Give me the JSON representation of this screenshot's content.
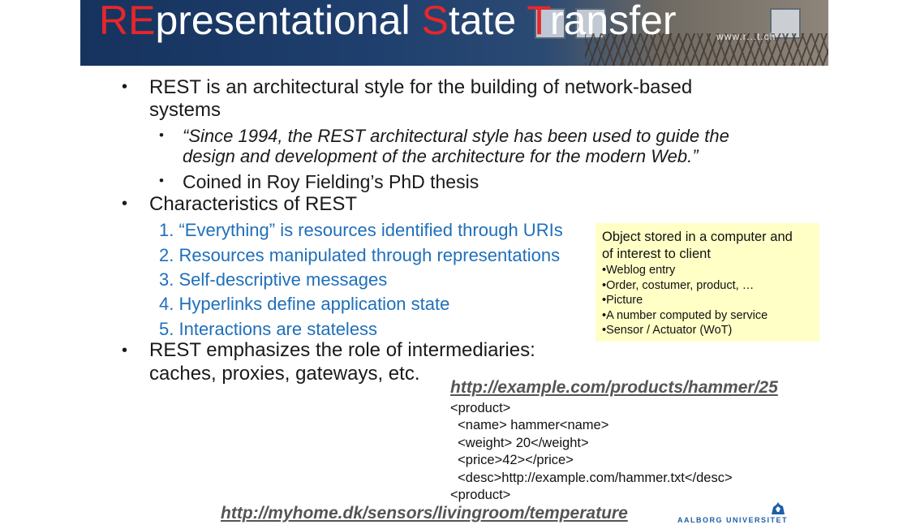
{
  "header": {
    "title_parts": [
      {
        "text": "RE",
        "accent": true
      },
      {
        "text": "presentational ",
        "accent": false
      },
      {
        "text": "S",
        "accent": true
      },
      {
        "text": "tate ",
        "accent": false
      },
      {
        "text": "T",
        "accent": true
      },
      {
        "text": "ransfer",
        "accent": false
      }
    ],
    "website": "www.r...t.ch"
  },
  "body": {
    "bullet_glyph": "•",
    "point1": {
      "line1": "REST is an architectural style for the building of network-based",
      "line2": "systems"
    },
    "quote": {
      "line1": "“Since 1994, the REST architectural style has been used to guide the",
      "line2": "design and development of the architecture for the modern Web.”"
    },
    "coined": "Coined in Roy Fielding’s PhD thesis",
    "characteristics_heading": "Characteristics of REST",
    "characteristics": [
      {
        "num": "1.",
        "text": "“Everything” is resources identified through URIs"
      },
      {
        "num": "2.",
        "text": "Resources manipulated through representations"
      },
      {
        "num": "3.",
        "text": "Self-descriptive messages"
      },
      {
        "num": "4.",
        "text": "Hyperlinks define application state"
      },
      {
        "num": "5.",
        "text": "Interactions are stateless"
      }
    ],
    "intermediaries": {
      "line1": "REST emphasizes the role of intermediaries:",
      "line2": "caches, proxies, gateways, etc."
    }
  },
  "note_box": {
    "heading_line1": "Object stored in a computer and",
    "heading_line2": "of interest to client",
    "items": [
      "•Weblog entry",
      "•Order, costumer, product, …",
      "•Picture",
      "•A number computed by service",
      "•Sensor / Actuator (WoT)"
    ]
  },
  "example": {
    "url": "http://example.com/products/hammer/25",
    "xml_lines": [
      "<product>",
      "  <name> hammer<name>",
      "  <weight> 20</weight>",
      "  <price>42></price>",
      "  <desc>http://example.com/hammer.txt</desc>",
      "<product>"
    ]
  },
  "sensor_url": "http://myhome.dk/sensors/livingroom/temperature",
  "logo": {
    "text": "AALBORG UNIVERSITET",
    "icon": "aau-seal-icon"
  },
  "colors": {
    "accent_red": "#e8262b",
    "list_blue": "#1f6fba",
    "note_bg": "#ffffc6",
    "banner_blue": "#1f3f6e",
    "url_gray": "#555555"
  }
}
